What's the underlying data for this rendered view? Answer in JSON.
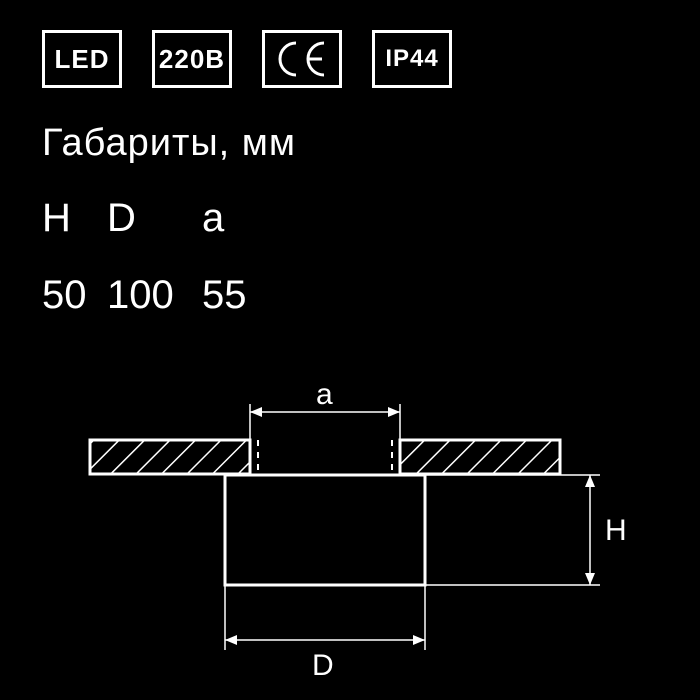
{
  "badges": {
    "led": "LED",
    "volts": "220В",
    "ce": "CE",
    "ip": "IP44"
  },
  "title": "Габариты, мм",
  "columns": {
    "h": "H",
    "d": "D",
    "a": "a"
  },
  "values": {
    "h": "50",
    "d": "100",
    "a": "55"
  },
  "diagram_labels": {
    "a": "a",
    "d": "D",
    "h": "H"
  },
  "chart_data": {
    "type": "table",
    "title": "Габариты, мм",
    "columns": [
      "H",
      "D",
      "a"
    ],
    "rows": [
      [
        50,
        100,
        55
      ]
    ],
    "unit": "мм"
  }
}
